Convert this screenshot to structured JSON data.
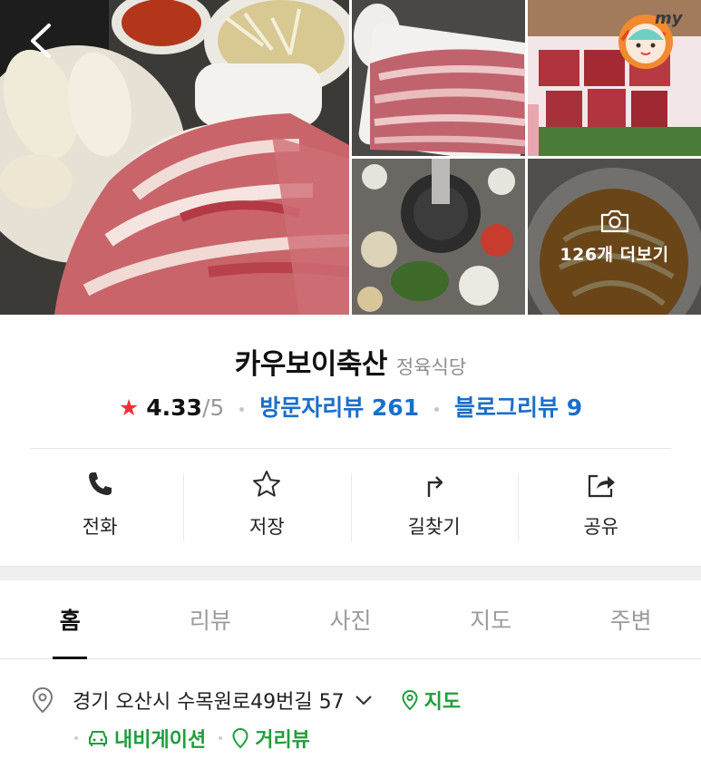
{
  "gallery": {
    "more_photos_label": "126개 더보기",
    "badge_text": "my"
  },
  "place": {
    "name": "카우보이축산",
    "category": "정육식당"
  },
  "rating": {
    "score": "4.33",
    "max": "/5",
    "visitor_reviews_label": "방문자리뷰 261",
    "blog_reviews_label": "블로그리뷰 9"
  },
  "actions": {
    "call": "전화",
    "save": "저장",
    "directions": "길찾기",
    "share": "공유"
  },
  "tabs": [
    {
      "label": "홈",
      "active": true
    },
    {
      "label": "리뷰",
      "active": false
    },
    {
      "label": "사진",
      "active": false
    },
    {
      "label": "지도",
      "active": false
    },
    {
      "label": "주변",
      "active": false
    }
  ],
  "address": {
    "text": "경기 오산시 수목원로49번길 57",
    "map_link": "지도",
    "navigation_link": "내비게이션",
    "street_view_link": "거리뷰"
  },
  "colors": {
    "accent_blue": "#1a6fc9",
    "accent_green": "#1e9e3a",
    "star_red": "#f2303a"
  }
}
